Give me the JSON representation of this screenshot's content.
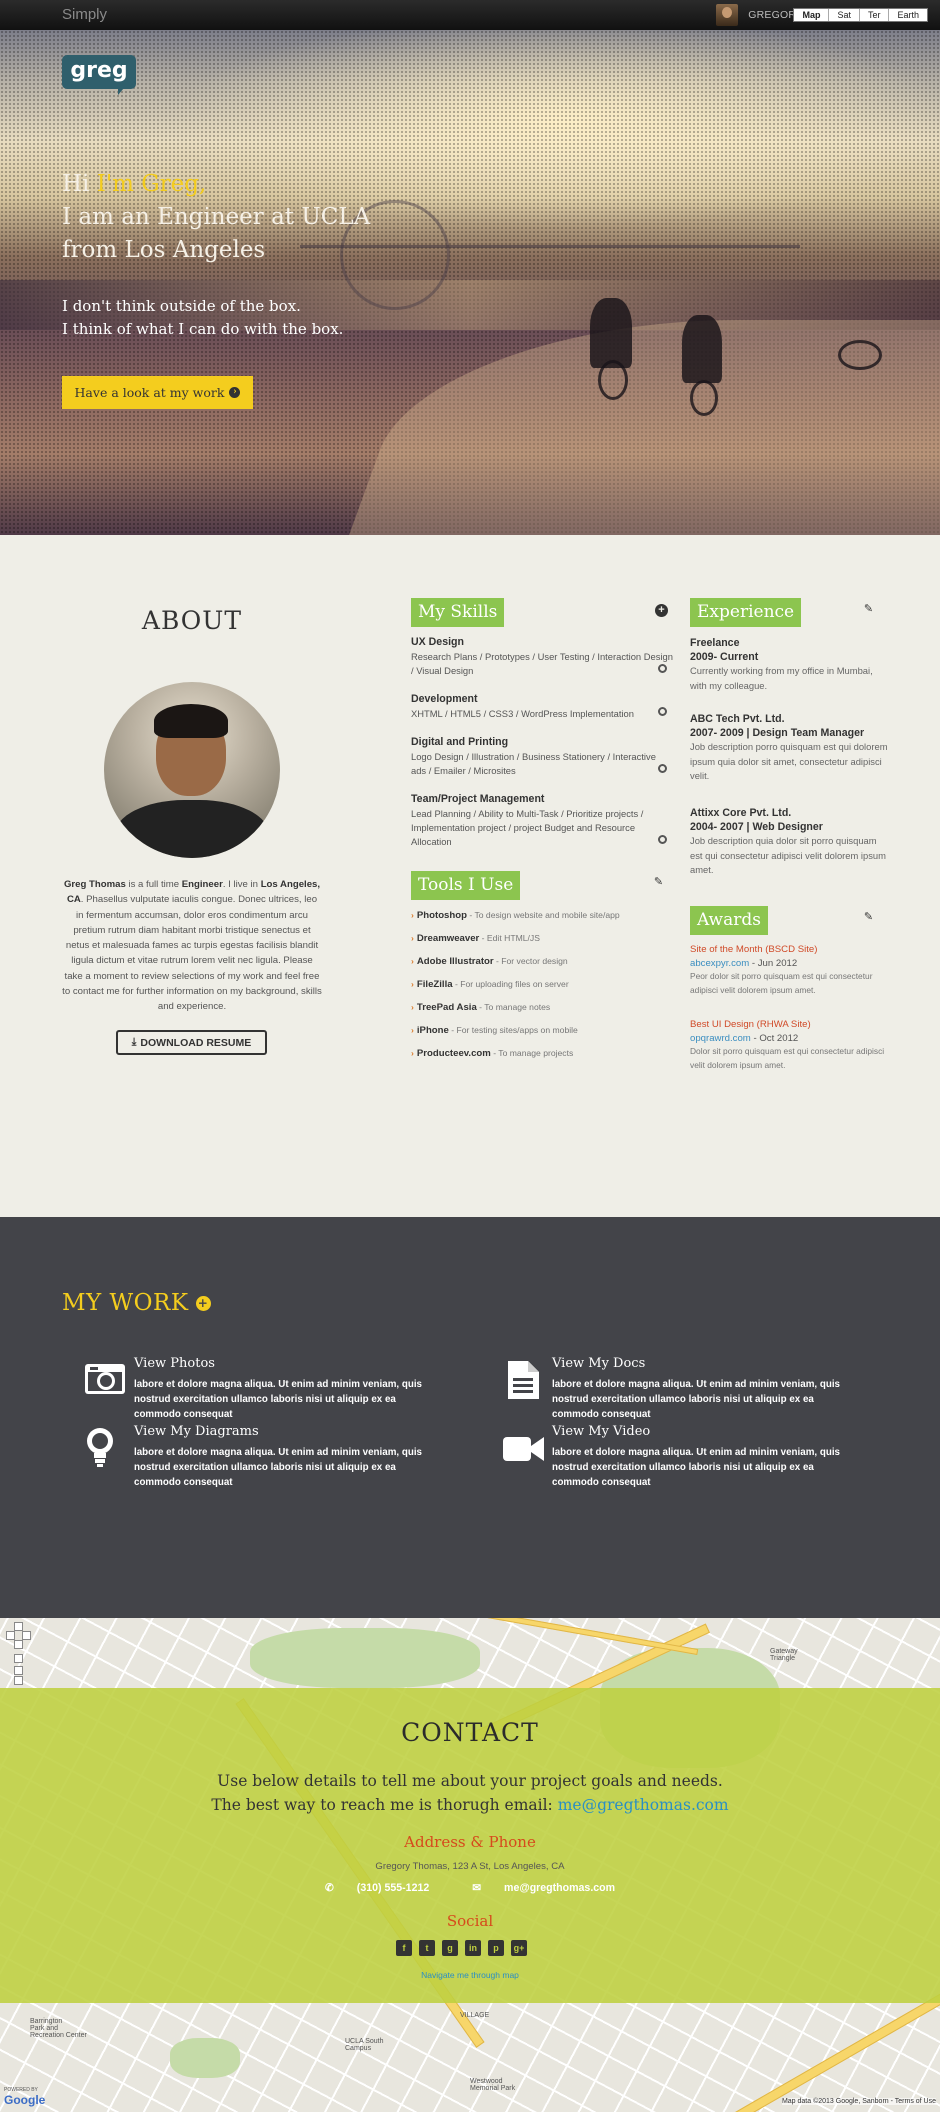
{
  "nav": {
    "brand": "Simply",
    "user": "GREGORY THOMAS"
  },
  "hero": {
    "logo": "greg",
    "hi": "Hi ",
    "name": "I'm Greg,",
    "line2": "I am an Engineer at UCLA",
    "line3": "from Los Angeles",
    "tag1": "I don't think outside of the box.",
    "tag2": "I think of what I can do with the box.",
    "button": "Have a look at my work"
  },
  "about": {
    "title": "ABOUT",
    "name": "Greg Thomas",
    "t1": " is a full time ",
    "role": "Engineer",
    "t2": ". I live in ",
    "city": "Los Angeles, CA",
    "t3": ". Phasellus vulputate iaculis congue. Donec ultrices, leo in fermentum accumsan, dolor eros condimentum arcu pretium rutrum diam habitant morbi tristique senectus et netus et malesuada fames ac turpis egestas facilisis blandit ligula dictum et vitae rutrum lorem velit nec ligula. Please take a moment to review selections of my work and feel free to contact me for further information on my background, skills and experience.",
    "button": "DOWNLOAD RESUME"
  },
  "skills": {
    "title": "My Skills",
    "items": [
      {
        "name": "UX Design",
        "desc": "Research Plans / Prototypes / User Testing / Interaction Design / Visual Design"
      },
      {
        "name": "Development",
        "desc": "XHTML / HTML5 / CSS3 / WordPress Implementation"
      },
      {
        "name": "Digital and Printing",
        "desc": "Logo Design / Illustration / Business Stationery / Interactive ads / Emailer / Microsites"
      },
      {
        "name": "Team/Project Management",
        "desc": "Lead Planning / Ability to Multi-Task / Prioritize projects / Implementation project / project Budget and Resource Allocation"
      }
    ]
  },
  "tools": {
    "title": "Tools I Use",
    "items": [
      {
        "name": "Photoshop",
        "desc": " - To design website and mobile site/app"
      },
      {
        "name": "Dreamweaver",
        "desc": " - Edit HTML/JS"
      },
      {
        "name": "Adobe Illustrator",
        "desc": " - For vector design"
      },
      {
        "name": "FileZilla",
        "desc": " - For uploading files on server"
      },
      {
        "name": "TreePad Asia",
        "desc": " - To manage notes"
      },
      {
        "name": "iPhone",
        "desc": " - For testing sites/apps on mobile"
      },
      {
        "name": "Producteev.com",
        "desc": " - To manage projects"
      }
    ]
  },
  "experience": {
    "title": "Experience",
    "items": [
      {
        "company": "Freelance",
        "period": "2009- Current",
        "desc": "Currently working from my office in Mumbai, with my colleague."
      },
      {
        "company": "ABC Tech Pvt. Ltd.",
        "period": "2007- 2009 | Design Team Manager",
        "desc": "Job description porro quisquam est qui dolorem ipsum quia dolor sit amet, consectetur adipisci velit."
      },
      {
        "company": "Attixx Core Pvt. Ltd.",
        "period": "2004- 2007 | Web Designer",
        "desc": "Job description quia dolor sit porro quisquam est qui consectetur adipisci velit dolorem ipsum amet."
      }
    ]
  },
  "awards": {
    "title": "Awards",
    "items": [
      {
        "title": "Site of the Month (BSCD Site)",
        "link": "abcexpyr.com",
        "date": " - Jun 2012",
        "desc": "Peor dolor sit porro quisquam est qui consectetur adipisci velit dolorem ipsum amet."
      },
      {
        "title": "Best UI Design (RHWA Site)",
        "link": "opqrawrd.com",
        "date": " - Oct 2012",
        "desc": "Dolor sit porro quisquam est qui consectetur adipisci velit dolorem ipsum amet."
      }
    ]
  },
  "work": {
    "title": "MY WORK",
    "items": [
      {
        "title": "View Photos",
        "desc": "labore et dolore magna aliqua. Ut enim ad minim veniam, quis nostrud exercitation ullamco laboris nisi ut aliquip ex ea commodo consequat"
      },
      {
        "title": "View My Docs",
        "desc": "labore et dolore magna aliqua. Ut enim ad minim veniam, quis nostrud exercitation ullamco laboris nisi ut aliquip ex ea commodo consequat"
      },
      {
        "title": "View My Diagrams",
        "desc": "labore et dolore magna aliqua. Ut enim ad minim veniam, quis nostrud exercitation ullamco laboris nisi ut aliquip ex ea commodo consequat"
      },
      {
        "title": "View My Video",
        "desc": "labore et dolore magna aliqua. Ut enim ad minim veniam, quis nostrud exercitation ullamco laboris nisi ut aliquip ex ea commodo consequat"
      }
    ]
  },
  "contact": {
    "title": "CONTACT",
    "line1": "Use below details to tell me about your project goals and needs.",
    "line2": "The best way to reach me is thorugh email: ",
    "email": "me@gregthomas.com",
    "addr_title": "Address & Phone",
    "address": "Gregory Thomas, 123 A St, Los Angeles, CA",
    "phone": "(310) 555-1212",
    "email2": "me@gregthomas.com",
    "social_title": "Social",
    "navigate": "Navigate me through map"
  },
  "map": {
    "types": [
      "Map",
      "Sat",
      "Ter",
      "Earth"
    ],
    "copyright": "Map data ©2013 Google, Sanborn - Terms of Use",
    "google": "Google",
    "powered": "POWERED BY"
  },
  "colors": {
    "accent": "#f4cd1e",
    "green": "#8cc54f",
    "dark": "#434449",
    "contact": "#bed040"
  }
}
